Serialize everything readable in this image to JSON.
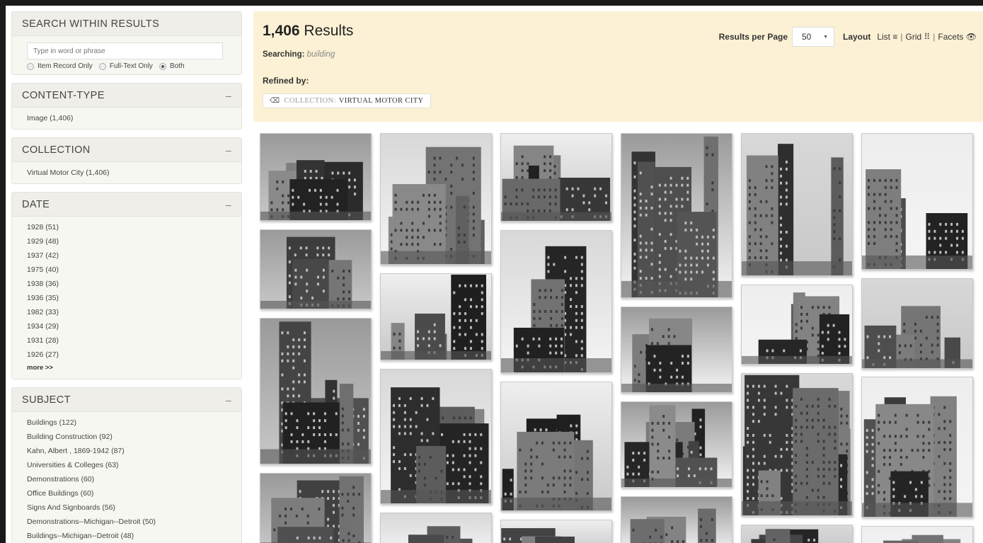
{
  "sidebar": {
    "search": {
      "title": "SEARCH WITHIN RESULTS",
      "placeholder": "Type in word or phrase",
      "options": [
        "Item Record Only",
        "Full-Text Only",
        "Both"
      ],
      "selected": "Both"
    },
    "content_type": {
      "title": "CONTENT-TYPE",
      "toggle": "–",
      "items": [
        "Image (1,406)"
      ]
    },
    "collection": {
      "title": "COLLECTION",
      "toggle": "–",
      "items": [
        "Virtual Motor City (1,406)"
      ]
    },
    "date": {
      "title": "DATE",
      "toggle": "–",
      "items": [
        "1928 (51)",
        "1929 (48)",
        "1937 (42)",
        "1975 (40)",
        "1938 (36)",
        "1936 (35)",
        "1982 (33)",
        "1934 (29)",
        "1931 (28)",
        "1926 (27)"
      ],
      "more": "more >>"
    },
    "subject": {
      "title": "SUBJECT",
      "toggle": "–",
      "items": [
        "Buildings (122)",
        "Building Construction (92)",
        "Kahn, Albert , 1869-1942 (87)",
        "Universities & Colleges (63)",
        "Demonstrations (60)",
        "Office Buildings (60)",
        "Signs And Signboards (56)",
        "Demonstrations--Michigan--Detroit (50)",
        "Buildings--Michigan--Detroit (48)"
      ]
    }
  },
  "results": {
    "count": "1,406",
    "count_suffix": "Results",
    "searching_label": "Searching:",
    "searching_term": "building",
    "refined_label": "Refined by:",
    "refine_tag": {
      "field": "COLLECTION:",
      "value": "VIRTUAL MOTOR CITY"
    }
  },
  "controls": {
    "rpp_label": "Results per Page",
    "rpp_value": "50",
    "layout_label": "Layout",
    "list_label": "List ≡",
    "grid_label": "Grid ⠿",
    "facets_label": "Facets 👁",
    "separator": "|"
  },
  "thumbnails": [
    {
      "name": "skyline-night"
    },
    {
      "name": "office-building-corner"
    },
    {
      "name": "street-buildings"
    },
    {
      "name": "art-deco-tower"
    },
    {
      "name": "tall-tower-street"
    },
    {
      "name": "steelworkers-beam"
    },
    {
      "name": "workers-chains"
    },
    {
      "name": "construction-street"
    },
    {
      "name": "foggy-skyline"
    },
    {
      "name": "workers-seated"
    },
    {
      "name": "victorian-mansion"
    },
    {
      "name": "factory-building"
    },
    {
      "name": "tower-upward"
    },
    {
      "name": "city-hall-tower"
    },
    {
      "name": "tree-building"
    },
    {
      "name": "group-portrait"
    },
    {
      "name": "steel-frame-construction"
    },
    {
      "name": "aerial-tower"
    },
    {
      "name": "stone-entrance"
    },
    {
      "name": "worker-partial"
    },
    {
      "name": "workers-crane-partial"
    },
    {
      "name": "workers-pole"
    },
    {
      "name": "sign-partial"
    },
    {
      "name": "building-partial"
    }
  ]
}
